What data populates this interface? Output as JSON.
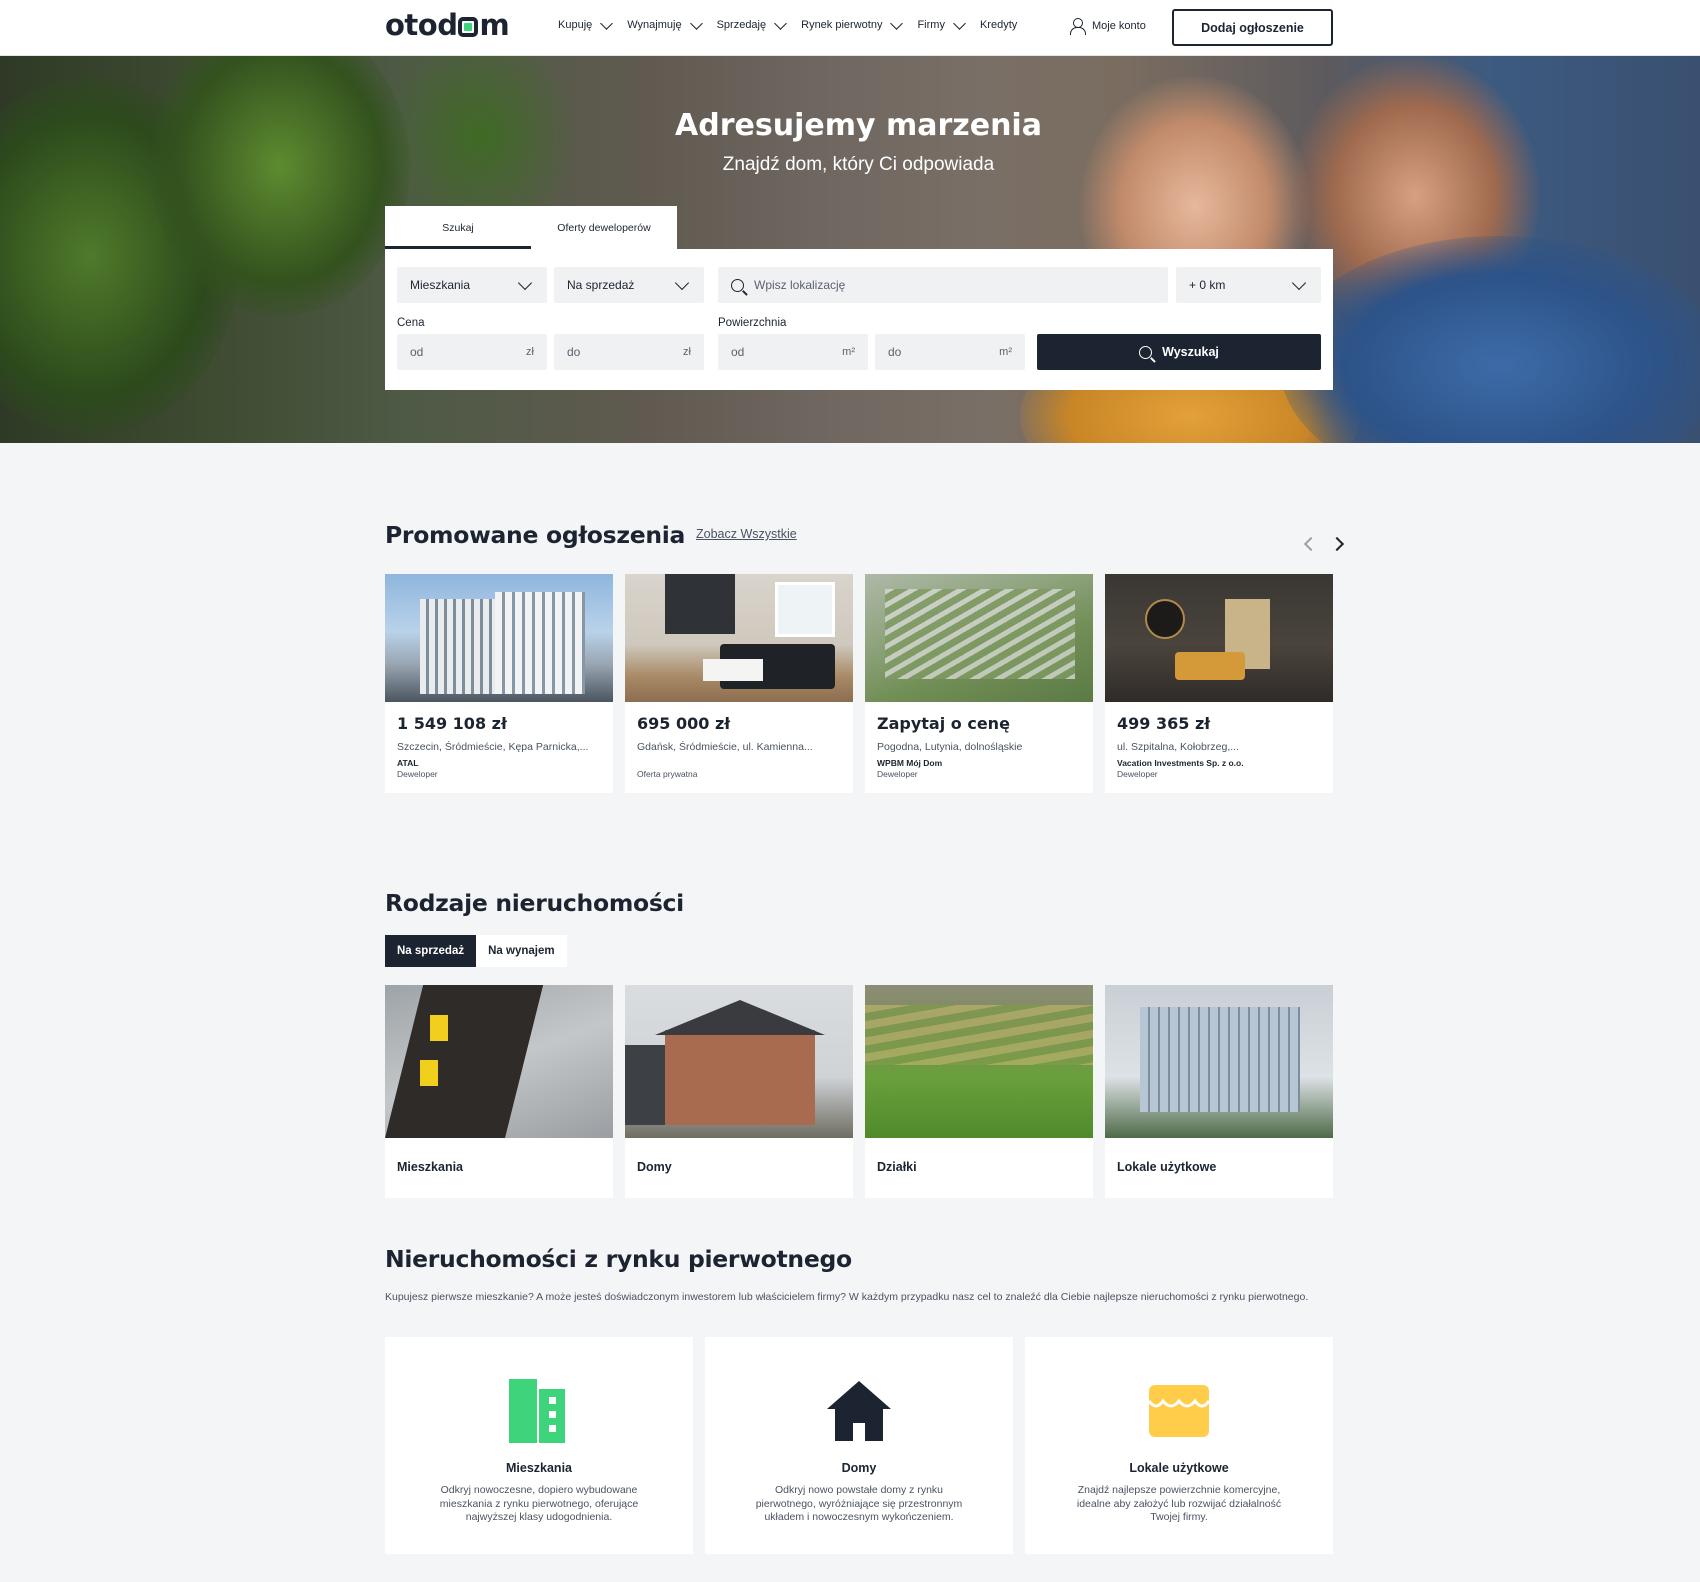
{
  "brand": {
    "logo_pre": "otod",
    "logo_post": "m",
    "accent": "#3ed47b",
    "dark": "#1b2430"
  },
  "nav": {
    "items": [
      "Kupuję",
      "Wynajmuję",
      "Sprzedaję",
      "Rynek pierwotny",
      "Firmy",
      "Kredyty"
    ]
  },
  "header": {
    "account_label": "Moje konto",
    "add_button": "Dodaj ogłoszenie"
  },
  "hero": {
    "title": "Adresujemy marzenia",
    "subtitle": "Znajdź dom, który Ci odpowiada"
  },
  "search": {
    "tabs": [
      "Szukaj",
      "Oferty deweloperów"
    ],
    "property_type": "Mieszkania",
    "transaction": "Na sprzedaż",
    "location_placeholder": "Wpisz lokalizację",
    "radius": "+ 0 km",
    "price_label": "Cena",
    "area_label": "Powierzchnia",
    "price_from": "od",
    "price_to": "do",
    "price_unit": "zł",
    "area_from": "od",
    "area_to": "do",
    "area_unit": "m²",
    "submit": "Wyszukaj"
  },
  "promoted": {
    "title": "Promowane ogłoszenia",
    "see_all": "Zobacz Wszystkie",
    "cards": [
      {
        "price": "1 549 108 zł",
        "location": "Szczecin, Śródmieście, Kępa Parnicka,...",
        "agency": "ATAL",
        "type": "Deweloper"
      },
      {
        "price": "695 000 zł",
        "location": "Gdańsk, Śródmieście, ul. Kamienna...",
        "agency": "",
        "type": "Oferta prywatna"
      },
      {
        "price": "Zapytaj o cenę",
        "location": "Pogodna, Lutynia, dolnośląskie",
        "agency": "WPBM Mój Dom",
        "type": "Deweloper"
      },
      {
        "price": "499 365 zł",
        "location": "ul. Szpitalna, Kołobrzeg,...",
        "agency": "Vacation Investments Sp. z o.o.",
        "type": "Deweloper"
      }
    ]
  },
  "types": {
    "title": "Rodzaje nieruchomości",
    "tabs": [
      "Na sprzedaż",
      "Na wynajem"
    ],
    "cards": [
      "Mieszkania",
      "Domy",
      "Działki",
      "Lokale użytkowe"
    ]
  },
  "market": {
    "title": "Nieruchomości z rynku pierwotnego",
    "description": "Kupujesz pierwsze mieszkanie? A może jesteś doświadczonym inwestorem lub właścicielem firmy? W każdym przypadku nasz cel to znaleźć dla Ciebie najlepsze nieruchomości z rynku pierwotnego.",
    "cards": [
      {
        "title": "Mieszkania",
        "text": "Odkryj nowoczesne, dopiero wybudowane mieszkania z rynku pierwotnego, oferujące najwyższej klasy udogodnienia.",
        "icon": "building-icon",
        "color": "#3ed47b"
      },
      {
        "title": "Domy",
        "text": "Odkryj nowo powstałe domy z rynku pierwotnego, wyróżniające się przestronnym układem i nowoczesnym wykończeniem.",
        "icon": "house-icon",
        "color": "#1b2430"
      },
      {
        "title": "Lokale użytkowe",
        "text": "Znajdź najlepsze powierzchnie komercyjne, idealne aby założyć lub rozwijać działalność Twojej firmy.",
        "icon": "shop-icon",
        "color": "#ffcd4a"
      }
    ]
  }
}
